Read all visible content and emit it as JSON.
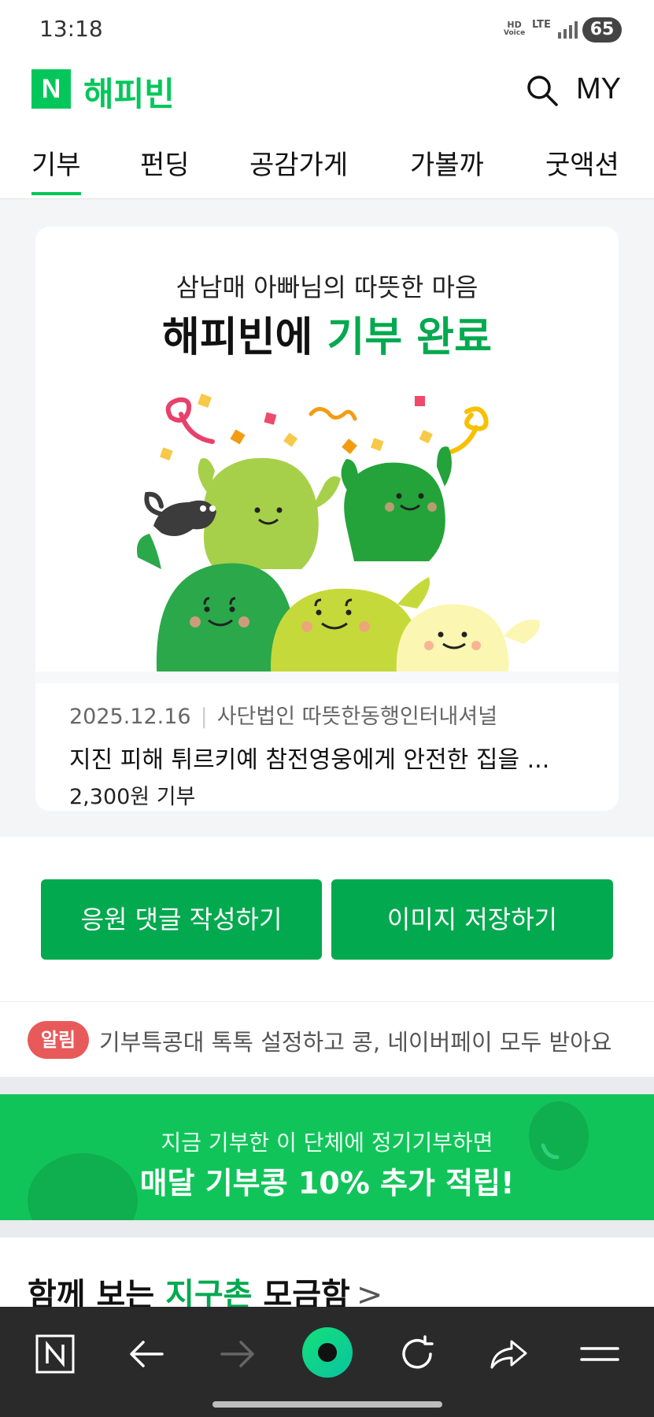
{
  "status_bar": {
    "time": "13:18",
    "hd_label": "HD",
    "voice_label": "Voice",
    "lte_label": "LTE",
    "battery": "65"
  },
  "header": {
    "logo_letter": "N",
    "logo_text": "해피빈",
    "my_label": "MY"
  },
  "tabs": [
    {
      "label": "기부",
      "active": true
    },
    {
      "label": "펀딩",
      "active": false
    },
    {
      "label": "공감가게",
      "active": false
    },
    {
      "label": "가볼까",
      "active": false
    },
    {
      "label": "굿액션",
      "active": false
    }
  ],
  "card": {
    "subtitle": "삼남매 아빠님의 따뜻한 마음",
    "headline_prefix": "해피빈에",
    "headline_highlight": "기부 완료",
    "date": "2025.12.16",
    "organization": "사단법인 따뜻한동행인터내셔널",
    "donation_title": "지진 피해 튀르키예 참전영웅에게 안전한 집을 ...",
    "amount": "2,300원 기부"
  },
  "buttons": {
    "comment": "응원 댓글 작성하기",
    "save_image": "이미지 저장하기"
  },
  "notice": {
    "badge": "알림",
    "text": "기부특콩대 톡톡 설정하고 콩, 네이버페이 모두 받아요"
  },
  "promo": {
    "line1": "지금 기부한 이 단체에 정기기부하면",
    "line2": "매달 기부콩 10% 추가 적립!"
  },
  "section": {
    "title_prefix": "함께 보는",
    "title_highlight": "지구촌",
    "title_suffix": "모금함",
    "chevron": ">"
  },
  "colors": {
    "brand_green": "#03c75a",
    "button_green": "#03a94f",
    "promo_green": "#11c45a",
    "badge_red": "#e85a5a"
  }
}
